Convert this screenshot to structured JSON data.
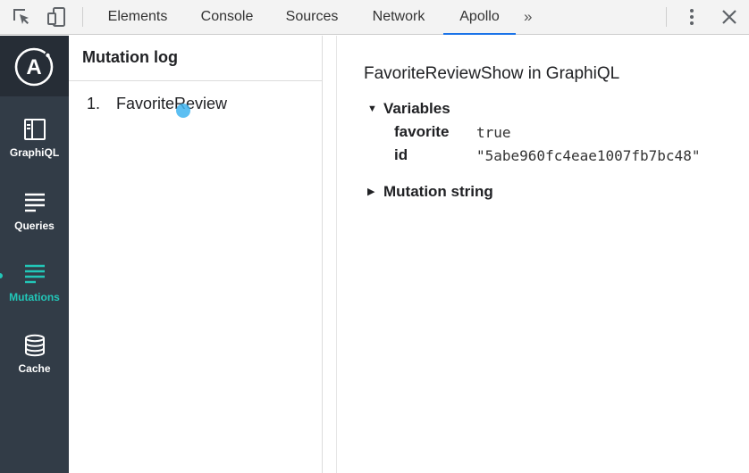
{
  "devtools": {
    "tabs": [
      {
        "label": "Elements"
      },
      {
        "label": "Console"
      },
      {
        "label": "Sources"
      },
      {
        "label": "Network"
      },
      {
        "label": "Apollo",
        "active": true
      }
    ],
    "more_tabs": "»",
    "icons": [
      "inspect-element-icon",
      "device-toolbar-icon",
      "more-menu-icon",
      "close-icon"
    ],
    "accent": "#1a73e8"
  },
  "sidebar": {
    "logo_letter": "A",
    "items": [
      {
        "label": "GraphiQL",
        "icon": "graphiql-icon"
      },
      {
        "label": "Queries",
        "icon": "queries-icon"
      },
      {
        "label": "Mutations",
        "icon": "mutations-icon",
        "active": true
      },
      {
        "label": "Cache",
        "icon": "cache-icon"
      }
    ],
    "background": "#323c47",
    "active_color": "#22c7b8"
  },
  "mutation_log": {
    "title": "Mutation log",
    "items": [
      {
        "number": "1.",
        "name": "FavoriteReview"
      }
    ]
  },
  "details": {
    "title": "FavoriteReviewShow in GraphiQL",
    "variables_label": "Variables",
    "variables": [
      {
        "key": "favorite",
        "value": "true"
      },
      {
        "key": "id",
        "value": "\"5abe960fc4eae1007fb7bc48\""
      }
    ],
    "mutation_string_label": "Mutation string"
  }
}
